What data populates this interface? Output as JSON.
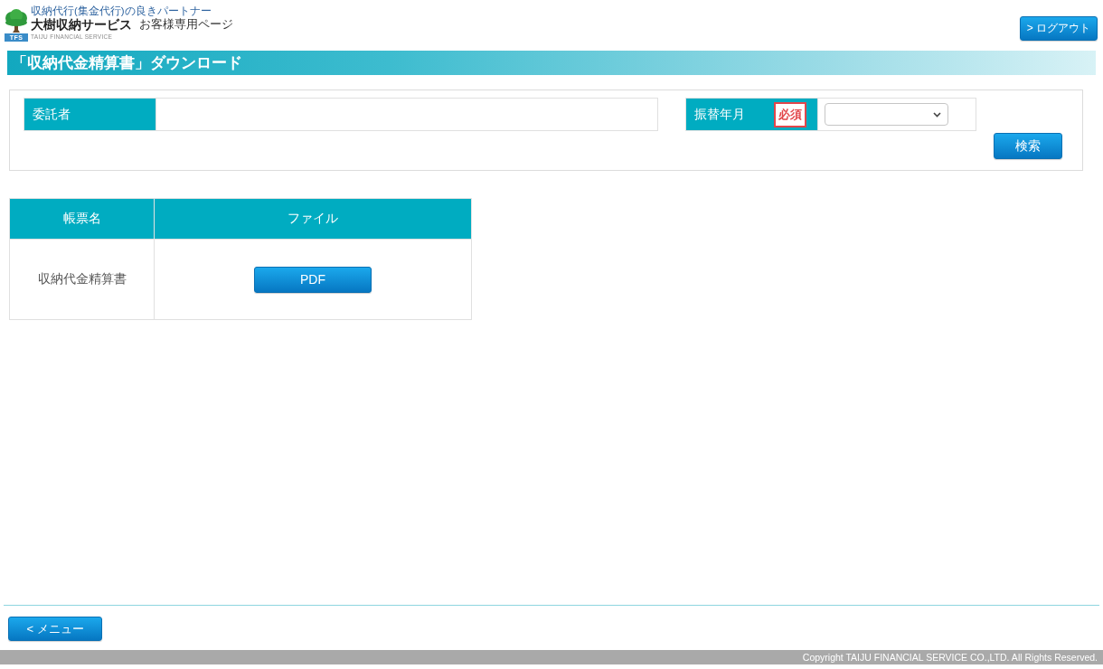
{
  "header": {
    "tagline": "収納代行(集金代行)の良きパートナー",
    "badge": "TFS",
    "brand": "大樹収納サービス",
    "brand_en": "TAIJU FINANCIAL SERVICE",
    "page_name": "お客様専用ページ",
    "logout_button": "> ログアウト"
  },
  "page_title": "「収納代金精算書」ダウンロード",
  "search": {
    "fields": [
      {
        "kind": "text",
        "label": "委託者",
        "required": false
      },
      {
        "kind": "select",
        "label": "振替年月",
        "required": true,
        "required_label": "必須"
      }
    ],
    "search_button": "検索"
  },
  "table": {
    "columns": [
      "帳票名",
      "ファイル"
    ],
    "rows": [
      {
        "name": "収納代金精算書",
        "file_button": "PDF"
      }
    ]
  },
  "footer": {
    "menu_button": "< メニュー",
    "copyright": "Copyright TAIJU FINANCIAL SERVICE CO.,LTD. All Rights Reserved."
  }
}
